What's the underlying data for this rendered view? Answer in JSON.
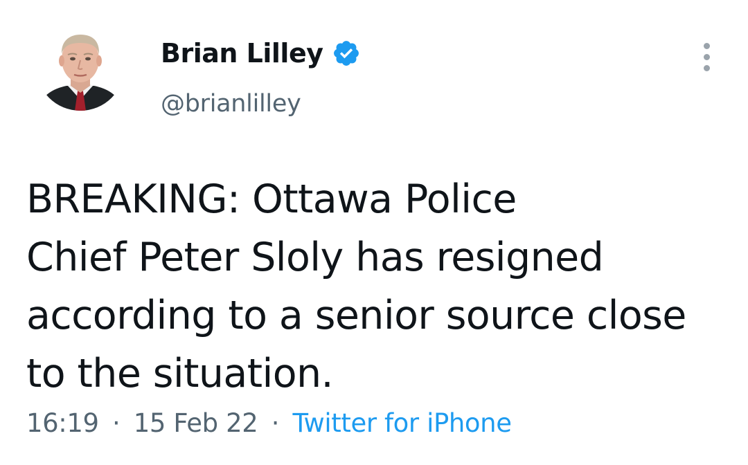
{
  "author": {
    "display_name": "Brian Lilley",
    "handle": "@brianlilley",
    "verified": true,
    "verified_icon": "verified-badge-icon",
    "avatar_icon": "profile-photo"
  },
  "menu": {
    "more_icon": "more-vertical-icon"
  },
  "tweet": {
    "lines": [
      "BREAKING: Ottawa Police",
      "Chief Peter Sloly has resigned",
      "according to a senior source close",
      "to the situation."
    ]
  },
  "meta": {
    "time": "16:19",
    "separator": "·",
    "date": "15 Feb 22",
    "source": "Twitter for iPhone"
  },
  "colors": {
    "text_primary": "#0f1419",
    "text_secondary": "#536471",
    "link": "#1d9bf0",
    "verified": "#1d9bf0"
  }
}
